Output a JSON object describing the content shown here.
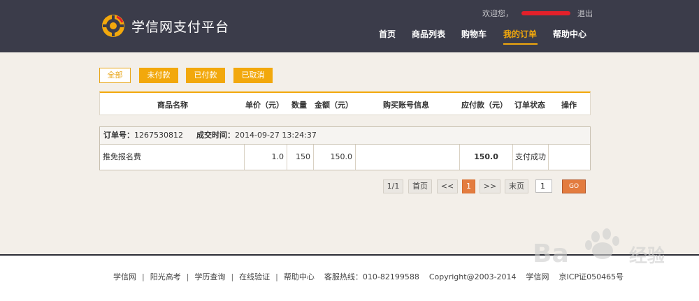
{
  "header": {
    "logo_text": "学信网支付平台",
    "welcome": "欢迎您，",
    "logout": "退出",
    "nav": [
      {
        "label": "首页"
      },
      {
        "label": "商品列表"
      },
      {
        "label": "购物车"
      },
      {
        "label": "我的订单",
        "active": true
      },
      {
        "label": "帮助中心"
      }
    ]
  },
  "filters": [
    {
      "label": "全部",
      "selected": true
    },
    {
      "label": "未付款"
    },
    {
      "label": "已付款"
    },
    {
      "label": "已取消"
    }
  ],
  "table": {
    "headers": [
      "商品名称",
      "单价（元）",
      "数量",
      "金额（元）",
      "购买账号信息",
      "应付款（元）",
      "订单状态",
      "操作"
    ]
  },
  "order": {
    "number_label": "订单号：",
    "number": "1267530812",
    "time_label": "成交时间：",
    "time": "2014-09-27 13:24:37",
    "item": {
      "name": "推免报名费",
      "unit_price": "1.0",
      "quantity": "150",
      "amount": "150.0",
      "account_info": "",
      "payable": "150.0",
      "status": "支付成功",
      "action": ""
    }
  },
  "pagination": {
    "page_info": "1/1",
    "first": "首页",
    "prev": "<<",
    "current": "1",
    "next": ">>",
    "last": "末页",
    "goto_value": "1",
    "go": "GO"
  },
  "footer": {
    "links": [
      "学信网",
      "阳光高考",
      "学历查询",
      "在线验证",
      "帮助中心"
    ],
    "hotline": "客服热线：010-82199588",
    "copyright": "Copyright@2003-2014",
    "site": "学信网",
    "icp": "京ICP证050465号"
  },
  "colors": {
    "header_bg": "#3b3c4a",
    "accent": "#f2a80c",
    "page_button": "#e37c3f",
    "page_bg": "#f3efe9"
  }
}
